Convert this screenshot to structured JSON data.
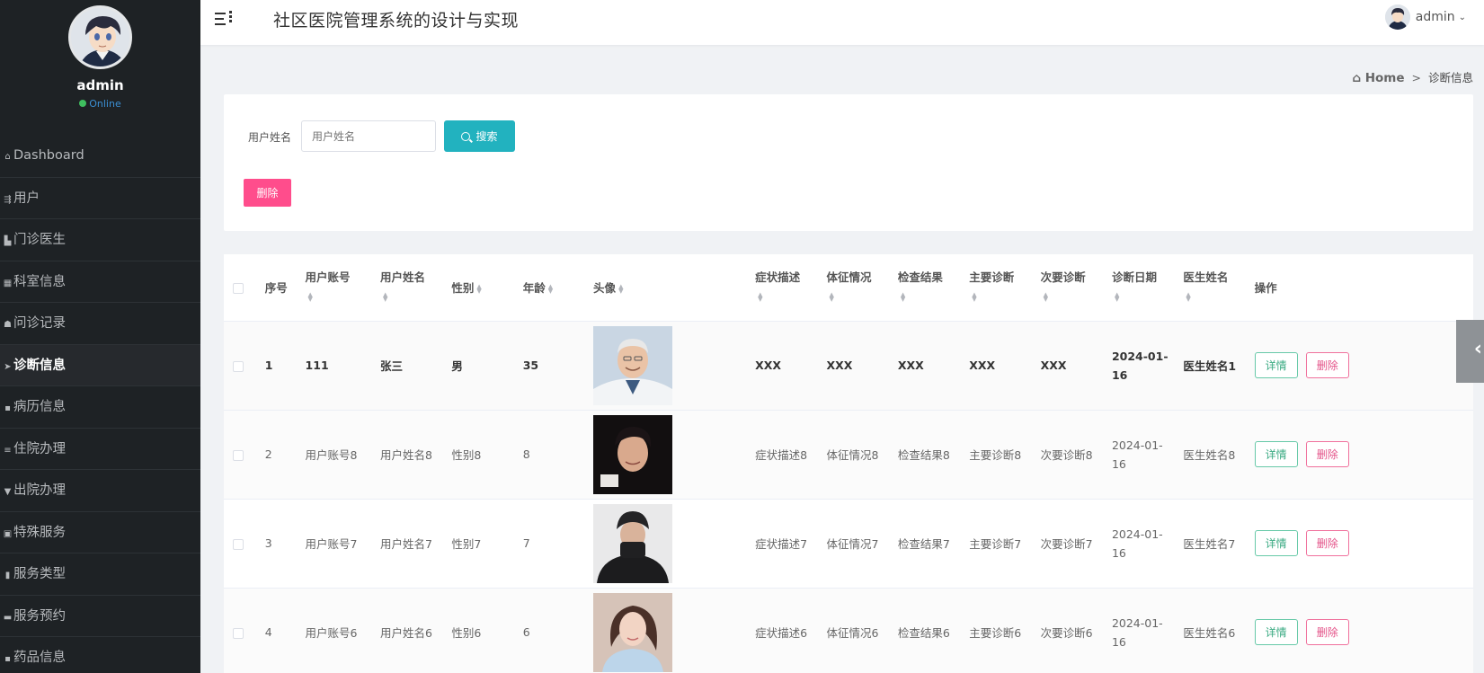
{
  "sidebar": {
    "username": "admin",
    "status": "Online",
    "items": [
      {
        "label": "Dashboard",
        "icon": "home-icon",
        "glyph": "⌂",
        "active": false
      },
      {
        "label": "用户",
        "icon": "sliders-icon",
        "glyph": "⇶",
        "active": false
      },
      {
        "label": "门诊医生",
        "icon": "book-icon",
        "glyph": "▙",
        "active": false
      },
      {
        "label": "科室信息",
        "icon": "grid-icon",
        "glyph": "▦",
        "active": false
      },
      {
        "label": "问诊记录",
        "icon": "thumbs-up-icon",
        "glyph": "☗",
        "active": false
      },
      {
        "label": "诊断信息",
        "icon": "paper-plane-icon",
        "glyph": "➤",
        "active": true
      },
      {
        "label": "病历信息",
        "icon": "apps-icon",
        "glyph": "▪",
        "active": false
      },
      {
        "label": "住院办理",
        "icon": "list-icon",
        "glyph": "≡",
        "active": false
      },
      {
        "label": "出院办理",
        "icon": "bullhorn-icon",
        "glyph": "▼",
        "active": false
      },
      {
        "label": "特殊服务",
        "icon": "trash-icon",
        "glyph": "▣",
        "active": false
      },
      {
        "label": "服务类型",
        "icon": "bar-chart-icon",
        "glyph": "▮",
        "active": false
      },
      {
        "label": "服务预约",
        "icon": "comment-icon",
        "glyph": "▬",
        "active": false
      },
      {
        "label": "药品信息",
        "icon": "apps-icon",
        "glyph": "▪",
        "active": false
      }
    ]
  },
  "header": {
    "title": "社区医院管理系统的设计与实现",
    "user": "admin"
  },
  "breadcrumb": {
    "home": "Home",
    "separator": ">",
    "current": "诊断信息"
  },
  "search": {
    "label": "用户姓名",
    "placeholder": "用户姓名",
    "button": "搜索",
    "delete_button": "删除"
  },
  "table": {
    "columns": [
      "序号",
      "用户账号",
      "用户姓名",
      "性别",
      "年龄",
      "头像",
      "症状描述",
      "体征情况",
      "检查结果",
      "主要诊断",
      "次要诊断",
      "诊断日期",
      "医生姓名",
      "操作"
    ],
    "rows": [
      {
        "no": "1",
        "account": "111",
        "name": "张三",
        "gender": "男",
        "age": "35",
        "symptom": "XXX",
        "sign": "XXX",
        "result": "XXX",
        "main": "XXX",
        "minor": "XXX",
        "date_a": "2024-01-",
        "date_b": "16",
        "doctor": "医生姓名1"
      },
      {
        "no": "2",
        "account": "用户账号8",
        "name": "用户姓名8",
        "gender": "性别8",
        "age": "8",
        "symptom": "症状描述8",
        "sign": "体征情况8",
        "result": "检查结果8",
        "main": "主要诊断8",
        "minor": "次要诊断8",
        "date_a": "2024-01-",
        "date_b": "16",
        "doctor": "医生姓名8"
      },
      {
        "no": "3",
        "account": "用户账号7",
        "name": "用户姓名7",
        "gender": "性别7",
        "age": "7",
        "symptom": "症状描述7",
        "sign": "体征情况7",
        "result": "检查结果7",
        "main": "主要诊断7",
        "minor": "次要诊断7",
        "date_a": "2024-01-",
        "date_b": "16",
        "doctor": "医生姓名7"
      },
      {
        "no": "4",
        "account": "用户账号6",
        "name": "用户姓名6",
        "gender": "性别6",
        "age": "6",
        "symptom": "症状描述6",
        "sign": "体征情况6",
        "result": "检查结果6",
        "main": "主要诊断6",
        "minor": "次要诊断6",
        "date_a": "2024-01-",
        "date_b": "16",
        "doctor": "医生姓名6"
      }
    ],
    "detail_button": "详情",
    "delete_button": "删除"
  },
  "colors": {
    "sidebar_bg": "#1e2225",
    "search_button": "#22b2bf",
    "delete_button": "#ff4d8c",
    "detail_border": "#67c9a8",
    "remove_border": "#f0709c"
  }
}
